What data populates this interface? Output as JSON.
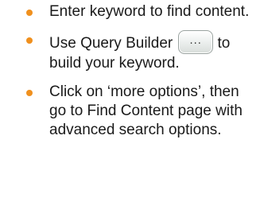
{
  "colors": {
    "bullet": "#f0901e",
    "text": "#1a1a1a"
  },
  "tips": [
    {
      "text": "Enter keyword to find content."
    },
    {
      "before": "Use Query Builder",
      "after": "to build your keyword."
    },
    {
      "text": "Click on ‘more options’, then go to Find Content page with advanced search options."
    }
  ],
  "query_builder_button": {
    "icon": "ellipsis-icon",
    "glyph": "..."
  }
}
